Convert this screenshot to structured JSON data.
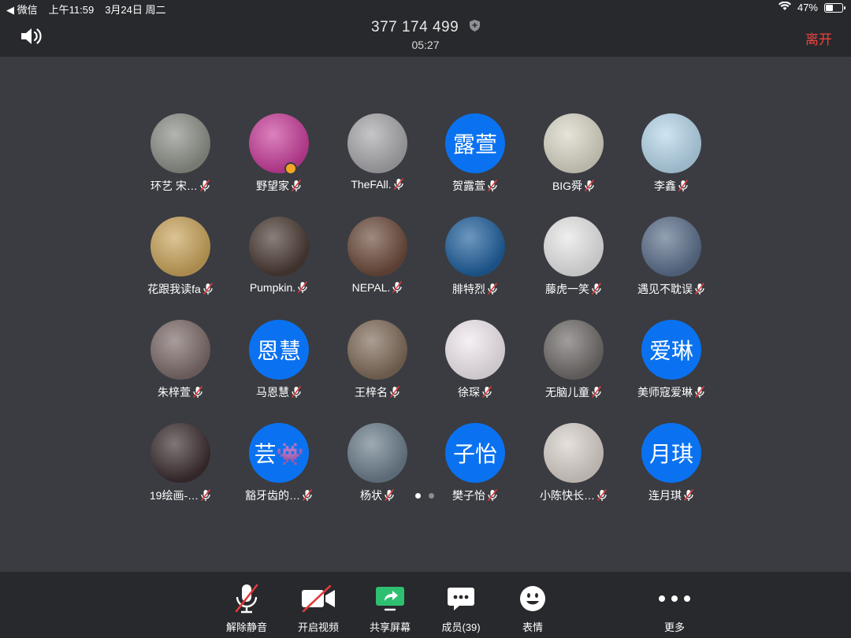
{
  "statusbar": {
    "back_app": "◀ 微信",
    "time": "上午11:59",
    "date": "3月24日 周二",
    "battery": "47%",
    "battery_level": 0.47
  },
  "header": {
    "meeting_id": "377 174 499",
    "duration": "05:27",
    "leave_label": "离开"
  },
  "participants": [
    {
      "name": "环艺 宋…",
      "avatar_text": "",
      "color": "#8a8f86"
    },
    {
      "name": "野望家",
      "avatar_text": "",
      "color": "#c83e9a",
      "host": true
    },
    {
      "name": "TheFAll.",
      "avatar_text": "",
      "color": "#a7a7ab"
    },
    {
      "name": "贺露萱",
      "avatar_text": "露萱",
      "color": "#0a72f0"
    },
    {
      "name": "BIG舜",
      "avatar_text": "",
      "color": "#d9d6c6"
    },
    {
      "name": "李鑫",
      "avatar_text": "",
      "color": "#b5d6ea"
    },
    {
      "name": "花跟我读fa",
      "avatar_text": "",
      "color": "#c8a35a"
    },
    {
      "name": "Pumpkin.",
      "avatar_text": "",
      "color": "#4a3a33"
    },
    {
      "name": "NEPAL.",
      "avatar_text": "",
      "color": "#6b4a3b"
    },
    {
      "name": "腓特烈",
      "avatar_text": "",
      "color": "#1f5f9c"
    },
    {
      "name": "藤虎一笑",
      "avatar_text": "",
      "color": "#e6e6e6"
    },
    {
      "name": "遇见不耽误",
      "avatar_text": "",
      "color": "#5a6e8a"
    },
    {
      "name": "朱梓萱",
      "avatar_text": "",
      "color": "#7b6a68"
    },
    {
      "name": "马恩慧",
      "avatar_text": "恩慧",
      "color": "#0a72f0"
    },
    {
      "name": "王梓名",
      "avatar_text": "",
      "color": "#7e6a58"
    },
    {
      "name": "徐琛",
      "avatar_text": "",
      "color": "#f1e9ef"
    },
    {
      "name": "无脑儿童",
      "avatar_text": "",
      "color": "#6e6a68"
    },
    {
      "name": "美师寇爱琳",
      "avatar_text": "爱琳",
      "color": "#0a72f0"
    },
    {
      "name": "19绘画-…",
      "avatar_text": "",
      "color": "#3b2d2f"
    },
    {
      "name": "豁牙齿的…",
      "avatar_text": "芸👾",
      "color": "#0a72f0"
    },
    {
      "name": "杨状",
      "avatar_text": "",
      "color": "#6a7c8a"
    },
    {
      "name": "樊子怡",
      "avatar_text": "子怡",
      "color": "#0a72f0"
    },
    {
      "name": "小陈快长…",
      "avatar_text": "",
      "color": "#d8d0ca"
    },
    {
      "name": "连月琪",
      "avatar_text": "月琪",
      "color": "#0a72f0"
    }
  ],
  "pager": {
    "pages": 2,
    "current": 1
  },
  "toolbar": {
    "unmute": "解除静音",
    "video": "开启视频",
    "share": "共享屏幕",
    "members": "成员(39)",
    "reactions": "表情",
    "more": "更多"
  }
}
